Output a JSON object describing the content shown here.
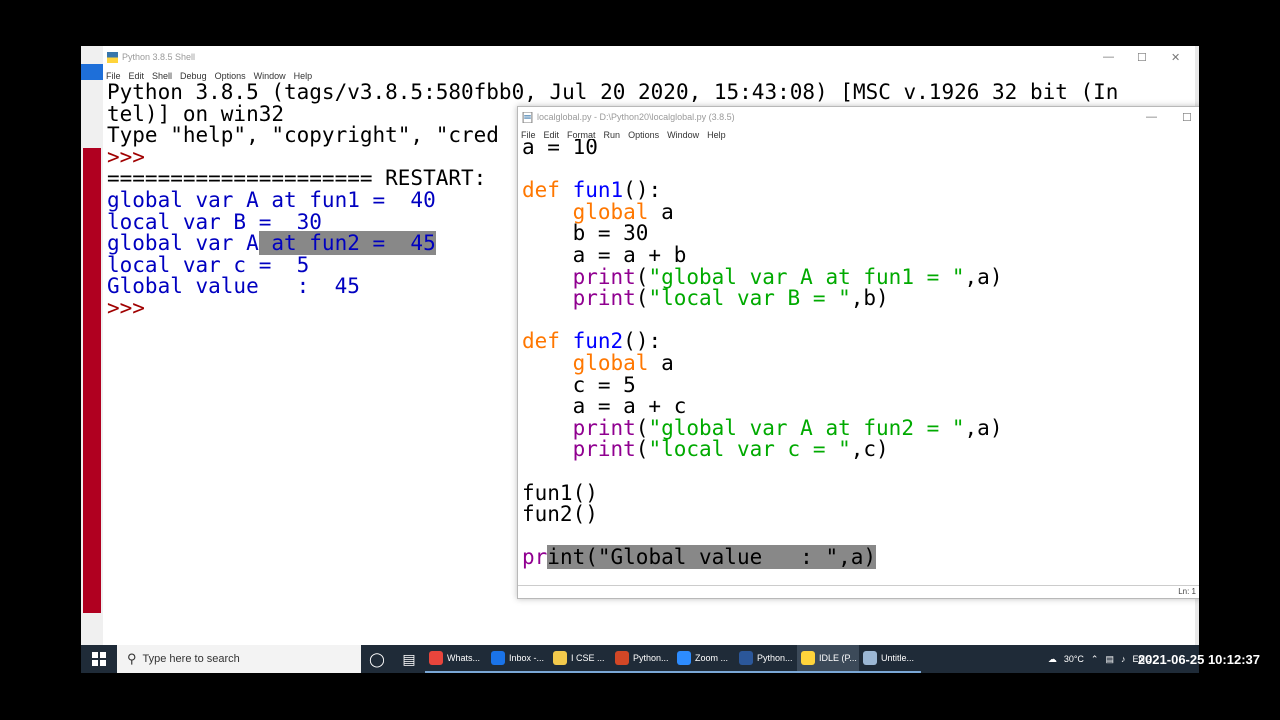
{
  "shell": {
    "title": "Python 3.8.5 Shell",
    "menu": [
      "File",
      "Edit",
      "Shell",
      "Debug",
      "Options",
      "Window",
      "Help"
    ],
    "lines": [
      [
        {
          "t": "Python 3.8.5 (tags/v3.8.5:580fbb0, Jul 20 2020, 15:43:08) [MSC v.1926 32 bit (In",
          "c": "k"
        }
      ],
      [
        {
          "t": "tel)] on win32",
          "c": "k"
        }
      ],
      [
        {
          "t": "Type \"help\", \"copyright\", \"cred",
          "c": "k"
        }
      ],
      [
        {
          "t": ">>> ",
          "c": "p"
        }
      ],
      [
        {
          "t": "===================== RESTART: ",
          "c": "k"
        }
      ],
      [
        {
          "t": "global var A at fun1 =  40",
          "c": "o"
        }
      ],
      [
        {
          "t": "local var B =  30",
          "c": "o"
        }
      ],
      [
        {
          "t": "global var A",
          "c": "o"
        },
        {
          "t": " at fun2 =  45",
          "c": "o",
          "sel": true
        }
      ],
      [
        {
          "t": "local var c =  5",
          "c": "o"
        }
      ],
      [
        {
          "t": "Global value   :  45",
          "c": "o"
        }
      ],
      [
        {
          "t": ">>> ",
          "c": "p"
        }
      ]
    ]
  },
  "editor": {
    "title": "localglobal.py - D:\\Python20\\localglobal.py (3.8.5)",
    "menu": [
      "File",
      "Edit",
      "Format",
      "Run",
      "Options",
      "Window",
      "Help"
    ],
    "status": "Ln: 1",
    "lines": [
      [
        {
          "t": "a = 10",
          "c": "k"
        }
      ],
      [],
      [
        {
          "t": "def",
          "c": "kw"
        },
        {
          "t": " ",
          "c": "k"
        },
        {
          "t": "fun1",
          "c": "fn"
        },
        {
          "t": "():",
          "c": "k"
        }
      ],
      [
        {
          "t": "    ",
          "c": "k"
        },
        {
          "t": "global",
          "c": "kw"
        },
        {
          "t": " a",
          "c": "k"
        }
      ],
      [
        {
          "t": "    b = 30",
          "c": "k"
        }
      ],
      [
        {
          "t": "    a = a + b",
          "c": "k"
        }
      ],
      [
        {
          "t": "    ",
          "c": "k"
        },
        {
          "t": "print",
          "c": "bi"
        },
        {
          "t": "(",
          "c": "k"
        },
        {
          "t": "\"global var A at fun1 = \"",
          "c": "st"
        },
        {
          "t": ",a)",
          "c": "k"
        }
      ],
      [
        {
          "t": "    ",
          "c": "k"
        },
        {
          "t": "print",
          "c": "bi"
        },
        {
          "t": "(",
          "c": "k"
        },
        {
          "t": "\"local var B = \"",
          "c": "st"
        },
        {
          "t": ",b)",
          "c": "k"
        }
      ],
      [],
      [
        {
          "t": "def",
          "c": "kw"
        },
        {
          "t": " ",
          "c": "k"
        },
        {
          "t": "fun2",
          "c": "fn"
        },
        {
          "t": "():",
          "c": "k"
        }
      ],
      [
        {
          "t": "    ",
          "c": "k"
        },
        {
          "t": "global",
          "c": "kw"
        },
        {
          "t": " a",
          "c": "k"
        }
      ],
      [
        {
          "t": "    c = 5",
          "c": "k"
        }
      ],
      [
        {
          "t": "    a = a + c",
          "c": "k"
        }
      ],
      [
        {
          "t": "    ",
          "c": "k"
        },
        {
          "t": "print",
          "c": "bi"
        },
        {
          "t": "(",
          "c": "k"
        },
        {
          "t": "\"global var A at fun2 = \"",
          "c": "st"
        },
        {
          "t": ",a)",
          "c": "k"
        }
      ],
      [
        {
          "t": "    ",
          "c": "k"
        },
        {
          "t": "print",
          "c": "bi"
        },
        {
          "t": "(",
          "c": "k"
        },
        {
          "t": "\"local var c = \"",
          "c": "st"
        },
        {
          "t": ",c)",
          "c": "k"
        }
      ],
      [],
      [
        {
          "t": "fun1()",
          "c": "k"
        }
      ],
      [
        {
          "t": "fun2()",
          "c": "k"
        }
      ],
      [],
      [
        {
          "t": "pr",
          "c": "bi"
        },
        {
          "t": "int(\"Global value   : \",a)",
          "c": "k",
          "sel": true
        }
      ]
    ]
  },
  "taskbar": {
    "search_placeholder": "Type here to search",
    "apps": [
      {
        "label": "Whats...",
        "color": "#e8453c"
      },
      {
        "label": "Inbox -...",
        "color": "#1a73e8"
      },
      {
        "label": "I CSE ...",
        "color": "#f2c94c"
      },
      {
        "label": "Python...",
        "color": "#d24726"
      },
      {
        "label": "Zoom ...",
        "color": "#2d8cff"
      },
      {
        "label": "Python...",
        "color": "#2b579a"
      },
      {
        "label": "IDLE (P...",
        "color": "#ffd43b",
        "active": true
      },
      {
        "label": "Untitle...",
        "color": "#9bb7d4"
      }
    ],
    "temperature": "30°C",
    "language": "ENG"
  },
  "timestamp": "2021-06-25 10:12:37"
}
